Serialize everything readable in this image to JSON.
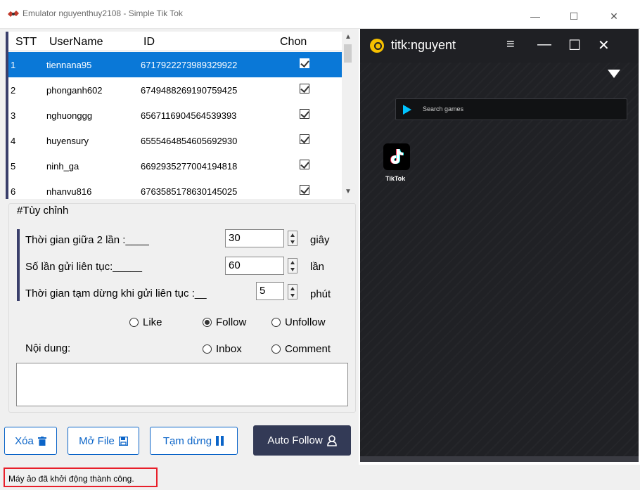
{
  "window": {
    "title": "Emulator nguyenthuy2108 - Simple Tik Tok",
    "minimize": "—",
    "maximize": "☐",
    "close": "✕"
  },
  "grid": {
    "columns": [
      "STT",
      "UserName",
      "ID",
      "Chon"
    ],
    "rows": [
      {
        "stt": "1",
        "username": "tiennana95",
        "id": "6717922273989329922",
        "chon": true
      },
      {
        "stt": "2",
        "username": "phonganh602",
        "id": "6749488269190759425",
        "chon": true
      },
      {
        "stt": "3",
        "username": "nghuonggg",
        "id": "6567116904564539393",
        "chon": true
      },
      {
        "stt": "4",
        "username": "huyensury",
        "id": "6555464854605692930",
        "chon": true
      },
      {
        "stt": "5",
        "username": "ninh_ga",
        "id": "6692935277004194818",
        "chon": true
      },
      {
        "stt": "6",
        "username": "nhanvu816",
        "id": "6763585178630145025",
        "chon": true
      }
    ],
    "selected_row": 0
  },
  "settings": {
    "title": "#Tùy chỉnh",
    "interval_label": "Thời gian giữa 2 lần :____",
    "interval_value": "30",
    "interval_unit": "giây",
    "count_label": "Số lần gửi liên tục:_____",
    "count_value": "60",
    "count_unit": "lần",
    "pause_label": "Thời gian tạm dừng khi gửi liên tục :__",
    "pause_value": "5",
    "pause_unit": "phút",
    "content_label": "Nội dung:",
    "content_value": ""
  },
  "actions": [
    {
      "key": "like",
      "label": "Like",
      "checked": false
    },
    {
      "key": "follow",
      "label": "Follow",
      "checked": true
    },
    {
      "key": "unfollow",
      "label": "Unfollow",
      "checked": false
    },
    {
      "key": "inbox",
      "label": "Inbox",
      "checked": false
    },
    {
      "key": "comment",
      "label": "Comment",
      "checked": false
    }
  ],
  "buttons": {
    "delete": "Xóa",
    "open_file": "Mở File",
    "pause": "Tạm dừng",
    "auto_follow": "Auto Follow"
  },
  "status": {
    "text": "Máy ảo đã khởi động thành công."
  },
  "emulator": {
    "title": "titk:nguyent",
    "search_placeholder": "Search games",
    "app_label": "TikTok"
  },
  "colors": {
    "selection": "#0a78d7",
    "accent": "#3a3f6b",
    "button_blue": "#0a64c8",
    "button_dark": "#333a56",
    "status_border": "#e81f2a"
  }
}
